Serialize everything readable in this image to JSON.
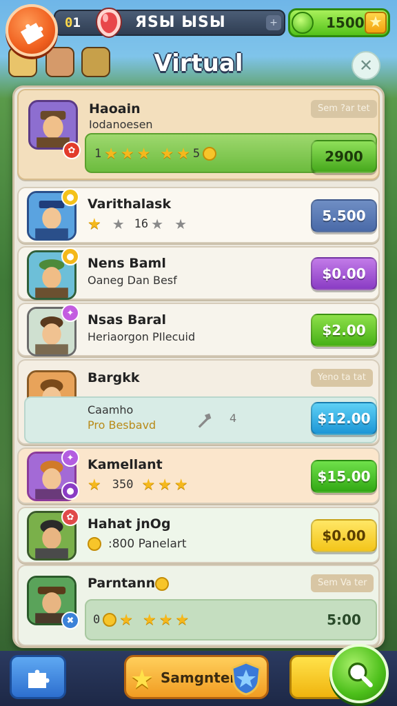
{
  "header": {
    "level_prefix": "0",
    "level_number": "1",
    "status_title": "ЯSЫ ЫSЫ",
    "coins": "1500",
    "page_title": "Virtual",
    "close_symbol": "✕",
    "plus_symbol": "+"
  },
  "colors": {
    "accent_orange": "#f0601f",
    "accent_green": "#53c21a",
    "panel_bg": "#ece8de"
  },
  "icons": {
    "back": "puzzle-icon",
    "gem": "gem-icon",
    "coin": "coin-icon",
    "star": "star-icon",
    "search": "search-icon",
    "shield": "shield-icon"
  },
  "items": [
    {
      "name": "Haoain",
      "subtitle": "Iodanoesen",
      "tag": "Sem ?ar tet",
      "stars_text_left": "1",
      "stars_text_mid": "5",
      "price": "2900"
    },
    {
      "name": "Varithalask",
      "stars_num": "16",
      "price": "5.500"
    },
    {
      "name": "Nens Baml",
      "subtitle": "Oaneg Dan Besf",
      "price": "$0.00"
    },
    {
      "name": "Nsas Baral",
      "subtitle": "Heriaorgon PIlecuid",
      "price": "$2.00"
    },
    {
      "name": "Bargkk",
      "tag": "Yeno ta tat",
      "subtitle": "Caamho",
      "subtitle2": "Pro Besbavd",
      "mid_number": "4",
      "price": "$12.00"
    },
    {
      "name": "Kamellant",
      "stars_num": "350",
      "price": "$15.00"
    },
    {
      "name": "Hahat jnOg",
      "subtitle": ":800  Panelart",
      "price": "$0.00"
    },
    {
      "name": "Parntanno",
      "tag": "Sem Va ter",
      "stars_text_left": "0",
      "price": "5:00"
    }
  ],
  "bottom": {
    "center_label": "Samgnter"
  }
}
